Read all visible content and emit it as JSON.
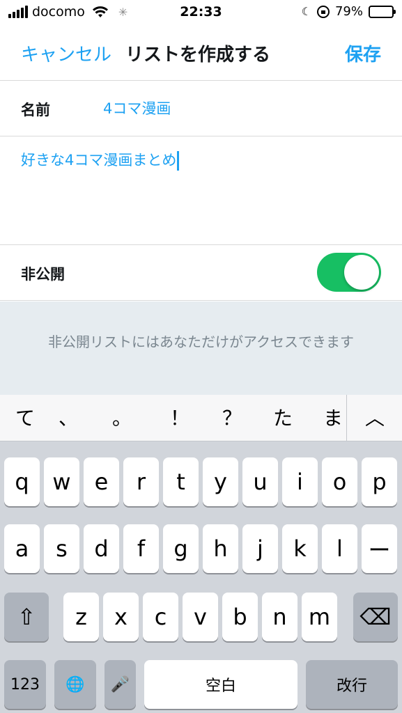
{
  "status": {
    "carrier": "docomo",
    "time": "22:33",
    "battery": "79%",
    "battery_level": 0.79,
    "moon": "☾",
    "spinner": "✳"
  },
  "nav": {
    "cancel": "キャンセル",
    "title": "リストを作成する",
    "save": "保存"
  },
  "form": {
    "name_label": "名前",
    "name_value": "4コマ漫画",
    "description": "好きな4コマ漫画まとめ",
    "private_label": "非公開",
    "private_on": true,
    "private_note": "非公開リストにはあなただけがアクセスできます"
  },
  "keyboard": {
    "suggestions": [
      "て",
      "、",
      "。",
      "！",
      "？",
      "た",
      "ま"
    ],
    "expand": "︿",
    "row1": [
      "q",
      "w",
      "e",
      "r",
      "t",
      "y",
      "u",
      "i",
      "o",
      "p"
    ],
    "row2": [
      "a",
      "s",
      "d",
      "f",
      "g",
      "h",
      "j",
      "k",
      "l",
      "ー"
    ],
    "row3": [
      "z",
      "x",
      "c",
      "v",
      "b",
      "n",
      "m"
    ],
    "shift_icon": "⇧",
    "delete_icon": "⌫",
    "num": "123",
    "globe_icon": "🌐",
    "mic_icon": "🎤",
    "space": "空白",
    "return": "改行"
  }
}
